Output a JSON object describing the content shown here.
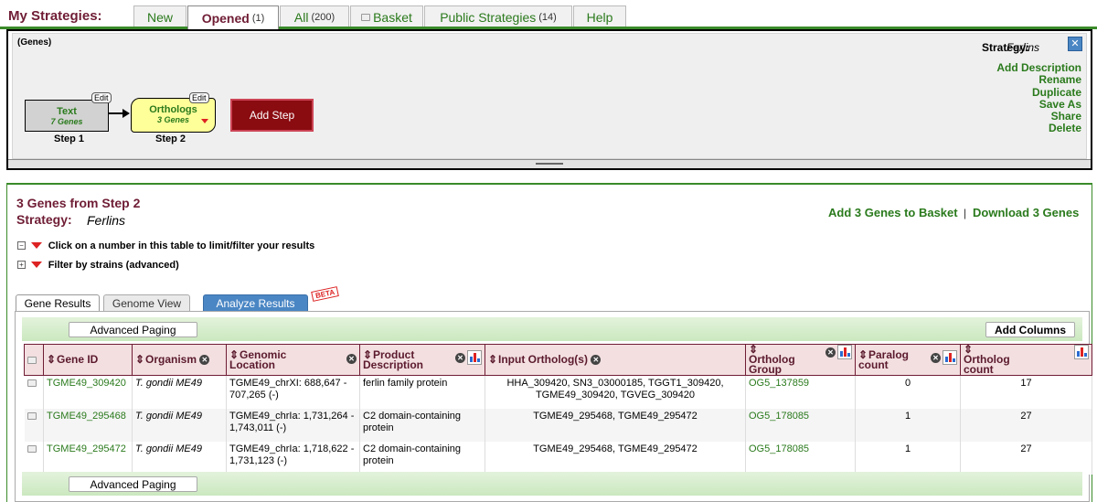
{
  "header": {
    "title": "My Strategies:"
  },
  "tabs": [
    {
      "label": "New",
      "count": ""
    },
    {
      "label": "Opened",
      "count": "(1)"
    },
    {
      "label": "All",
      "count": "(200)"
    },
    {
      "label": "Basket",
      "count": ""
    },
    {
      "label": "Public Strategies",
      "count": "(14)"
    },
    {
      "label": "Help",
      "count": ""
    }
  ],
  "strategy": {
    "record_type": "(Genes)",
    "name_label": "Strategy:",
    "name": "Ferlins",
    "actions": [
      "Add Description",
      "Rename",
      "Duplicate",
      "Save As",
      "Share",
      "Delete"
    ],
    "steps": [
      {
        "name": "Text",
        "count": "7 Genes",
        "label": "Step 1",
        "edit": "Edit"
      },
      {
        "name": "Orthologs",
        "count": "3 Genes",
        "label": "Step 2",
        "edit": "Edit"
      }
    ],
    "add_step": "Add Step"
  },
  "results": {
    "title": "3 Genes  from Step 2",
    "strategy_label": "Strategy:",
    "strategy_name": "Ferlins",
    "add_basket": "Add 3 Genes to Basket",
    "download": "Download 3 Genes",
    "separator": "|",
    "filter1": "Click on a number in this table to limit/filter your results",
    "filter2": "Filter by strains (advanced)",
    "tabs": [
      "Gene Results",
      "Genome View",
      "Analyze Results"
    ],
    "beta": "BETA",
    "advanced_paging": "Advanced Paging",
    "add_columns": "Add Columns"
  },
  "table": {
    "headers": [
      "Gene ID",
      "Organism",
      "Genomic Location",
      "Product Description",
      "Input Ortholog(s)",
      "Ortholog Group",
      "Paralog count",
      "Ortholog count"
    ],
    "rows": [
      {
        "gene_id": "TGME49_309420",
        "organism": "T. gondii ME49",
        "location": "TGME49_chrXI: 688,647 - 707,265 (-)",
        "product": "ferlin family protein",
        "input_orthologs": "HHA_309420, SN3_03000185, TGGT1_309420, TGME49_309420, TGVEG_309420",
        "group": "OG5_137859",
        "paralog": "0",
        "ortholog": "17"
      },
      {
        "gene_id": "TGME49_295468",
        "organism": "T. gondii ME49",
        "location": "TGME49_chrIa: 1,731,264 - 1,743,011 (-)",
        "product": "C2 domain-containing protein",
        "input_orthologs": "TGME49_295468, TGME49_295472",
        "group": "OG5_178085",
        "paralog": "1",
        "ortholog": "27"
      },
      {
        "gene_id": "TGME49_295472",
        "organism": "T. gondii ME49",
        "location": "TGME49_chrIa: 1,718,622 - 1,731,123 (-)",
        "product": "C2 domain-containing protein",
        "input_orthologs": "TGME49_295468, TGME49_295472",
        "group": "OG5_178085",
        "paralog": "1",
        "ortholog": "27"
      }
    ]
  },
  "colors": {
    "brand": "#6f1d35",
    "link": "#2a7a1c",
    "add_step": "#8a0b10",
    "analyze": "#4a86c4"
  }
}
